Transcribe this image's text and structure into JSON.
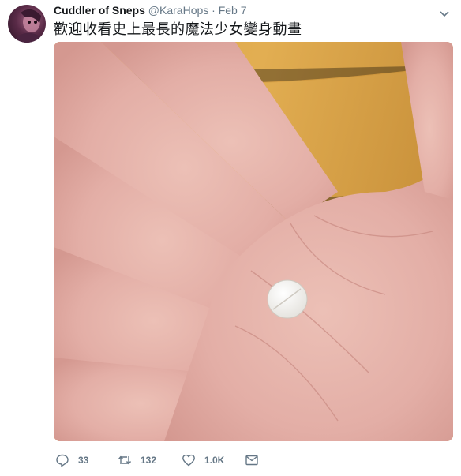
{
  "tweet": {
    "display_name": "Cuddler of Sneps",
    "handle": "@KaraHops",
    "separator": "·",
    "date": "Feb 7",
    "text": "歡迎收看史上最長的魔法少女變身動畫",
    "actions": {
      "replies": "33",
      "retweets": "132",
      "likes": "1.0K"
    },
    "icons": {
      "reply": "reply-icon",
      "retweet": "retweet-icon",
      "like": "heart-icon",
      "dm": "envelope-icon",
      "more": "chevron-down-icon"
    },
    "colors": {
      "text": "#14171a",
      "secondary": "#657786"
    }
  }
}
